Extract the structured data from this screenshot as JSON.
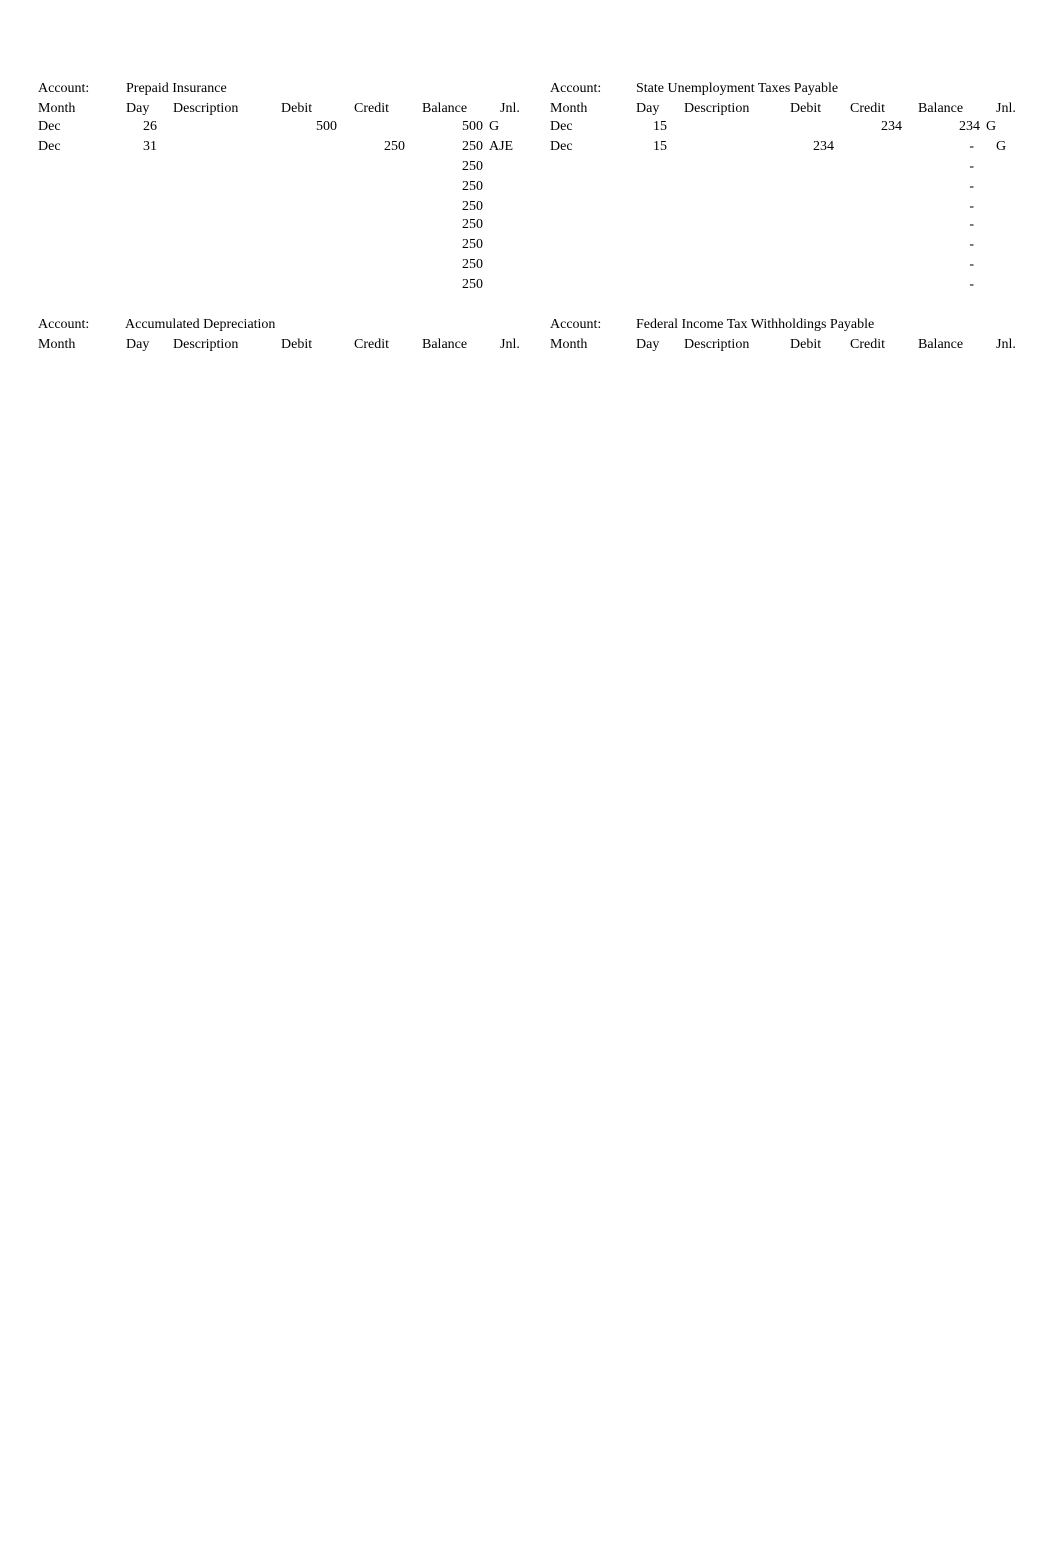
{
  "ledgers": [
    {
      "account_label": "Account:",
      "account_name": "Prepaid Insurance",
      "headers": [
        "Month",
        "Day",
        "Description",
        "Debit",
        "Credit",
        "Balance",
        "Jnl."
      ],
      "rows": [
        {
          "month": "Dec",
          "day": "26",
          "description": "",
          "debit": "500",
          "credit": "",
          "balance": "500",
          "jnl": "G"
        },
        {
          "month": "Dec",
          "day": "31",
          "description": "",
          "debit": "",
          "credit": "250",
          "balance": "250",
          "jnl": "AJE"
        },
        {
          "month": "",
          "day": "",
          "description": "",
          "debit": "",
          "credit": "",
          "balance": "250",
          "jnl": ""
        },
        {
          "month": "",
          "day": "",
          "description": "",
          "debit": "",
          "credit": "",
          "balance": "250",
          "jnl": ""
        },
        {
          "month": "",
          "day": "",
          "description": "",
          "debit": "",
          "credit": "",
          "balance": "250",
          "jnl": ""
        },
        {
          "month": "",
          "day": "",
          "description": "",
          "debit": "",
          "credit": "",
          "balance": "250",
          "jnl": ""
        },
        {
          "month": "",
          "day": "",
          "description": "",
          "debit": "",
          "credit": "",
          "balance": "250",
          "jnl": ""
        },
        {
          "month": "",
          "day": "",
          "description": "",
          "debit": "",
          "credit": "",
          "balance": "250",
          "jnl": ""
        },
        {
          "month": "",
          "day": "",
          "description": "",
          "debit": "",
          "credit": "",
          "balance": "250",
          "jnl": ""
        }
      ]
    },
    {
      "account_label": "Account:",
      "account_name": "State Unemployment Taxes Payable",
      "headers": [
        "Month",
        "Day",
        "Description",
        "Debit",
        "Credit",
        "Balance",
        "Jnl."
      ],
      "rows": [
        {
          "month": "Dec",
          "day": "15",
          "description": "",
          "debit": "",
          "credit": "234",
          "balance": "234",
          "jnl": "G"
        },
        {
          "month": "Dec",
          "day": "15",
          "description": "",
          "debit": "234",
          "credit": "",
          "balance": "-",
          "jnl": "G"
        },
        {
          "month": "",
          "day": "",
          "description": "",
          "debit": "",
          "credit": "",
          "balance": "-",
          "jnl": ""
        },
        {
          "month": "",
          "day": "",
          "description": "",
          "debit": "",
          "credit": "",
          "balance": "-",
          "jnl": ""
        },
        {
          "month": "",
          "day": "",
          "description": "",
          "debit": "",
          "credit": "",
          "balance": "-",
          "jnl": ""
        },
        {
          "month": "",
          "day": "",
          "description": "",
          "debit": "",
          "credit": "",
          "balance": "-",
          "jnl": ""
        },
        {
          "month": "",
          "day": "",
          "description": "",
          "debit": "",
          "credit": "",
          "balance": "-",
          "jnl": ""
        },
        {
          "month": "",
          "day": "",
          "description": "",
          "debit": "",
          "credit": "",
          "balance": "-",
          "jnl": ""
        },
        {
          "month": "",
          "day": "",
          "description": "",
          "debit": "",
          "credit": "",
          "balance": "-",
          "jnl": ""
        }
      ]
    },
    {
      "account_label": "Account:",
      "account_name": "Accumulated Depreciation",
      "headers": [
        "Month",
        "Day",
        "Description",
        "Debit",
        "Credit",
        "Balance",
        "Jnl."
      ],
      "rows": []
    },
    {
      "account_label": "Account:",
      "account_name": "Federal Income Tax Withholdings Payable",
      "headers": [
        "Month",
        "Day",
        "Description",
        "Debit",
        "Credit",
        "Balance",
        "Jnl."
      ],
      "rows": []
    }
  ]
}
